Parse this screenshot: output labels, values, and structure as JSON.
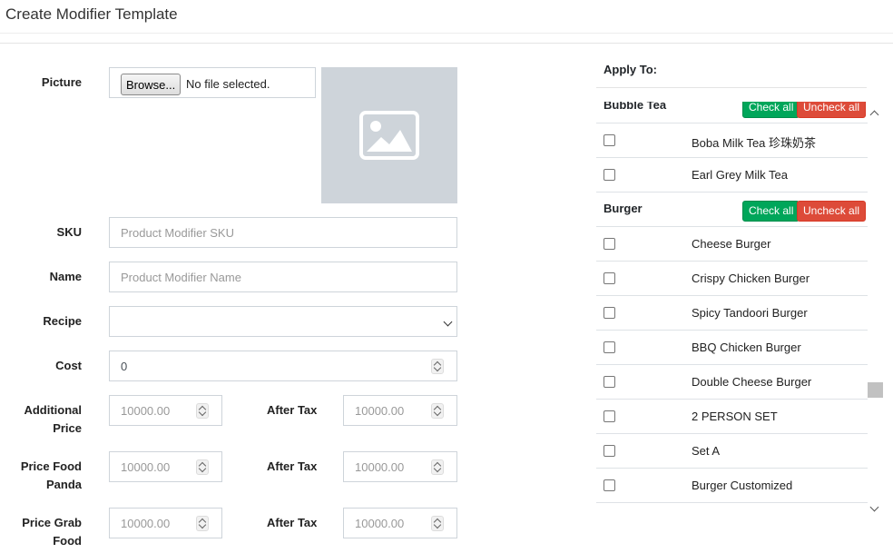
{
  "page": {
    "title": "Create Modifier Template"
  },
  "form": {
    "picture_label": "Picture",
    "browse_label": "Browse...",
    "no_file_text": "No file selected.",
    "sku_label": "SKU",
    "sku_placeholder": "Product Modifier SKU",
    "name_label": "Name",
    "name_placeholder": "Product Modifier Name",
    "recipe_label": "Recipe",
    "recipe_value": "",
    "cost_label": "Cost",
    "cost_value": "0",
    "additional_price_label": "Additional Price",
    "price_food_panda_label": "Price Food Panda",
    "price_grab_food_label": "Price Grab Food",
    "after_tax_label": "After Tax",
    "price_placeholder": "10000.00"
  },
  "apply": {
    "title": "Apply To:",
    "check_all": "Check all",
    "uncheck_all": "Uncheck all",
    "groups": [
      {
        "name": "Bubble Tea",
        "items": [
          "Boba Milk Tea 珍珠奶茶",
          "Earl Grey Milk Tea"
        ]
      },
      {
        "name": "Burger",
        "items": [
          "Cheese Burger",
          "Crispy Chicken Burger",
          "Spicy Tandoori Burger",
          "BBQ Chicken Burger",
          "Double Cheese Burger",
          "2 PERSON SET",
          "Set A",
          "Burger Customized"
        ]
      }
    ]
  },
  "icons": {
    "image_placeholder": "image-icon",
    "scroll_up": "chevron-up-icon",
    "scroll_down": "chevron-down-icon"
  },
  "colors": {
    "check_all": "#00a65a",
    "uncheck_all": "#dd4b39",
    "image_bg": "#ced4da"
  }
}
